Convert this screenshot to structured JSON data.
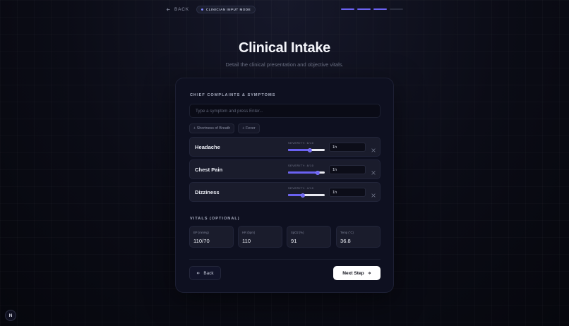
{
  "colors": {
    "accent": "#6b62f2",
    "background": "#0b0c16",
    "card": "#0e1020"
  },
  "top": {
    "back_label": "BACK",
    "mode_label": "CLINICIAN INPUT MODE",
    "progress_steps": [
      true,
      true,
      true,
      false
    ]
  },
  "page": {
    "title": "Clinical Intake",
    "subtitle": "Detail the clinical presentation and objective vitals."
  },
  "complaints": {
    "section_label": "CHIEF COMPLAINTS & SYMPTOMS",
    "input_placeholder": "Type a symptom and press Enter...",
    "suggestions": [
      "+ Shortness of Breath",
      "+ Fever"
    ],
    "symptoms": [
      {
        "name": "Headache",
        "severity_label": "SEVERITY: 6/10",
        "severity": 6,
        "duration": "1h"
      },
      {
        "name": "Chest Pain",
        "severity_label": "SEVERITY: 8/10",
        "severity": 8,
        "duration": "1h"
      },
      {
        "name": "Dizziness",
        "severity_label": "SEVERITY: 4/10",
        "severity": 4,
        "duration": "1h"
      }
    ]
  },
  "vitals": {
    "section_label": "VITALS (OPTIONAL)",
    "items": [
      {
        "label": "BP (mmHg)",
        "value": "110/70"
      },
      {
        "label": "HR (bpm)",
        "value": "110"
      },
      {
        "label": "SpO2 (%)",
        "value": "91"
      },
      {
        "label": "Temp (°C)",
        "value": "36.8"
      }
    ]
  },
  "actions": {
    "back_label": "Back",
    "next_label": "Next Step"
  },
  "footer": {
    "logo_letter": "N"
  }
}
